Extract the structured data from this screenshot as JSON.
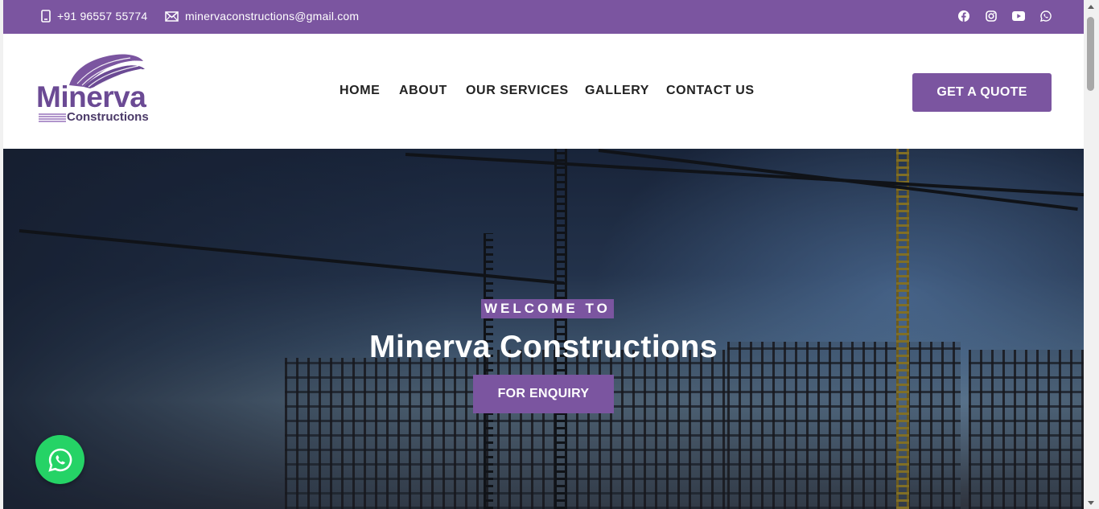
{
  "topbar": {
    "phone": "+91 96557 55774",
    "email": "minervaconstructions@gmail.com",
    "social": [
      "facebook-icon",
      "instagram-icon",
      "youtube-icon",
      "whatsapp-icon"
    ]
  },
  "logo": {
    "word1": "Minerva",
    "word2": "Constructions"
  },
  "nav": {
    "items": [
      {
        "label": "HOME"
      },
      {
        "label": "ABOUT"
      },
      {
        "label": "OUR SERVICES"
      },
      {
        "label": "GALLERY"
      },
      {
        "label": "CONTACT US"
      }
    ],
    "quote_label": "GET A QUOTE"
  },
  "hero": {
    "welcome": "WELCOME TO",
    "title": "Minerva Constructions",
    "button": "FOR ENQUIRY"
  },
  "colors": {
    "brand": "#7b55a0",
    "whatsapp": "#25d366"
  }
}
